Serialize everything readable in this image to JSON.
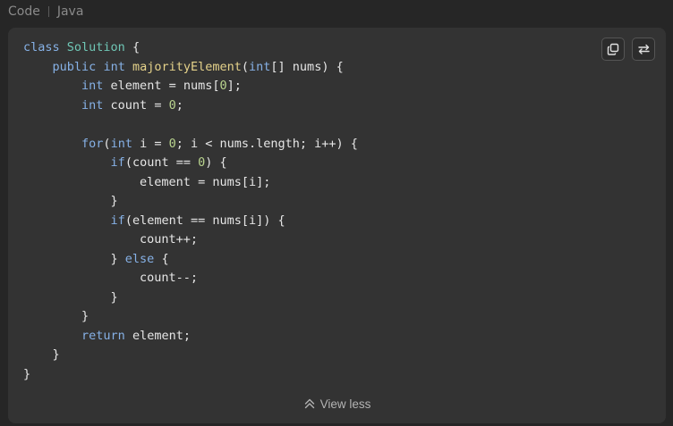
{
  "header": {
    "label": "Code",
    "language": "Java"
  },
  "toolbar": {
    "copy_icon": "copy-icon",
    "swap_icon": "swap-icon"
  },
  "code_lines": [
    [
      [
        "kw",
        "class"
      ],
      [
        "txt",
        " "
      ],
      [
        "cls",
        "Solution"
      ],
      [
        "txt",
        " {"
      ]
    ],
    [
      [
        "txt",
        "    "
      ],
      [
        "kw",
        "public"
      ],
      [
        "txt",
        " "
      ],
      [
        "kw",
        "int"
      ],
      [
        "txt",
        " "
      ],
      [
        "fn",
        "majorityElement"
      ],
      [
        "txt",
        "("
      ],
      [
        "kw",
        "int"
      ],
      [
        "txt",
        "[] nums) {"
      ]
    ],
    [
      [
        "txt",
        "        "
      ],
      [
        "kw",
        "int"
      ],
      [
        "txt",
        " element = nums["
      ],
      [
        "num",
        "0"
      ],
      [
        "txt",
        "];"
      ]
    ],
    [
      [
        "txt",
        "        "
      ],
      [
        "kw",
        "int"
      ],
      [
        "txt",
        " count = "
      ],
      [
        "num",
        "0"
      ],
      [
        "txt",
        ";"
      ]
    ],
    [
      [
        "txt",
        ""
      ]
    ],
    [
      [
        "txt",
        "        "
      ],
      [
        "kw",
        "for"
      ],
      [
        "txt",
        "("
      ],
      [
        "kw",
        "int"
      ],
      [
        "txt",
        " i = "
      ],
      [
        "num",
        "0"
      ],
      [
        "txt",
        "; i < nums.length; i++) {"
      ]
    ],
    [
      [
        "txt",
        "            "
      ],
      [
        "kw",
        "if"
      ],
      [
        "txt",
        "(count == "
      ],
      [
        "num",
        "0"
      ],
      [
        "txt",
        ") {"
      ]
    ],
    [
      [
        "txt",
        "                element = nums[i];"
      ]
    ],
    [
      [
        "txt",
        "            }"
      ]
    ],
    [
      [
        "txt",
        "            "
      ],
      [
        "kw",
        "if"
      ],
      [
        "txt",
        "(element == nums[i]) {"
      ]
    ],
    [
      [
        "txt",
        "                count++;"
      ]
    ],
    [
      [
        "txt",
        "            } "
      ],
      [
        "kw",
        "else"
      ],
      [
        "txt",
        " {"
      ]
    ],
    [
      [
        "txt",
        "                count--;"
      ]
    ],
    [
      [
        "txt",
        "            }"
      ]
    ],
    [
      [
        "txt",
        "        }"
      ]
    ],
    [
      [
        "txt",
        "        "
      ],
      [
        "kw",
        "return"
      ],
      [
        "txt",
        " element;"
      ]
    ],
    [
      [
        "txt",
        "    }"
      ]
    ],
    [
      [
        "txt",
        "}"
      ]
    ]
  ],
  "footer": {
    "view_less_label": "View less",
    "icon": "double-chevron-up-icon"
  },
  "colors": {
    "page_bg": "#262626",
    "panel_bg": "#333333",
    "keyword": "#86b1e6",
    "class_name": "#6fc6b5",
    "function_name": "#e5d28a",
    "number": "#b9d48e",
    "text": "#e6e6e6"
  }
}
